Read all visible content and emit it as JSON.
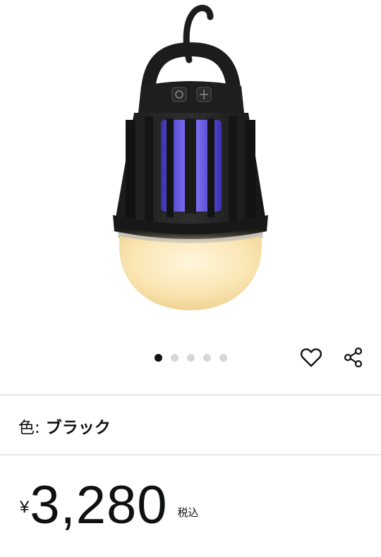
{
  "product": {
    "image_alt": "bug zapper lantern",
    "carousel": {
      "total": 5,
      "active_index": 0
    }
  },
  "actions": {
    "favorite_icon": "heart-icon",
    "share_icon": "share-icon"
  },
  "variant": {
    "label": "色:",
    "value": "ブラック"
  },
  "price": {
    "currency_symbol": "¥",
    "amount": "3,280",
    "tax_note": "税込"
  },
  "colors": {
    "dot_active": "#111111",
    "dot_inactive": "#d6d6d6",
    "divider": "#e6e6e6",
    "uv_glow": "#5b4ce0"
  }
}
